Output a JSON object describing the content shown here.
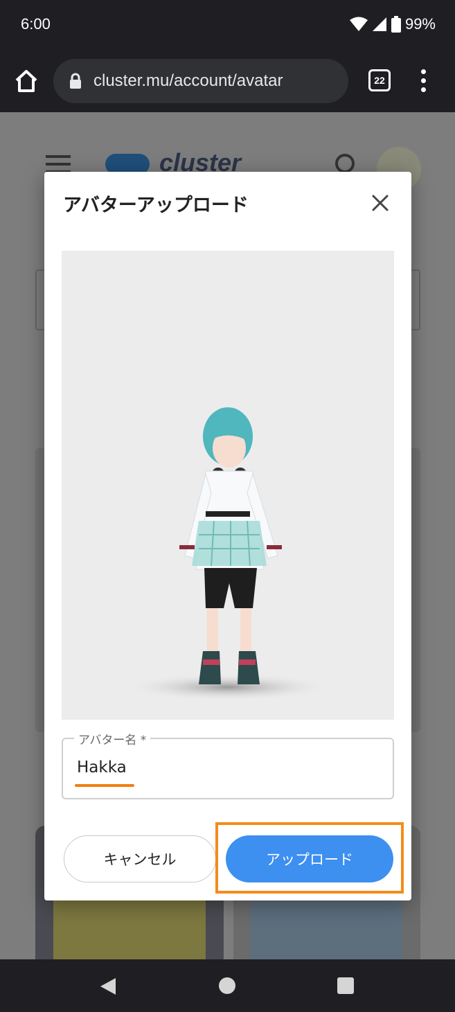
{
  "status_bar": {
    "time": "6:00",
    "battery": "99%"
  },
  "browser": {
    "url": "cluster.mu/account/avatar",
    "tab_count": "22"
  },
  "background_page": {
    "logo_text": "cluster"
  },
  "modal": {
    "title": "アバターアップロード",
    "field_label": "アバター名 *",
    "field_value": "Hakka",
    "cancel_label": "キャンセル",
    "upload_label": "アップロード"
  },
  "colors": {
    "accent_blue": "#3d8ff0",
    "highlight_orange": "#f48c1c",
    "underline_orange": "#f07f10"
  }
}
